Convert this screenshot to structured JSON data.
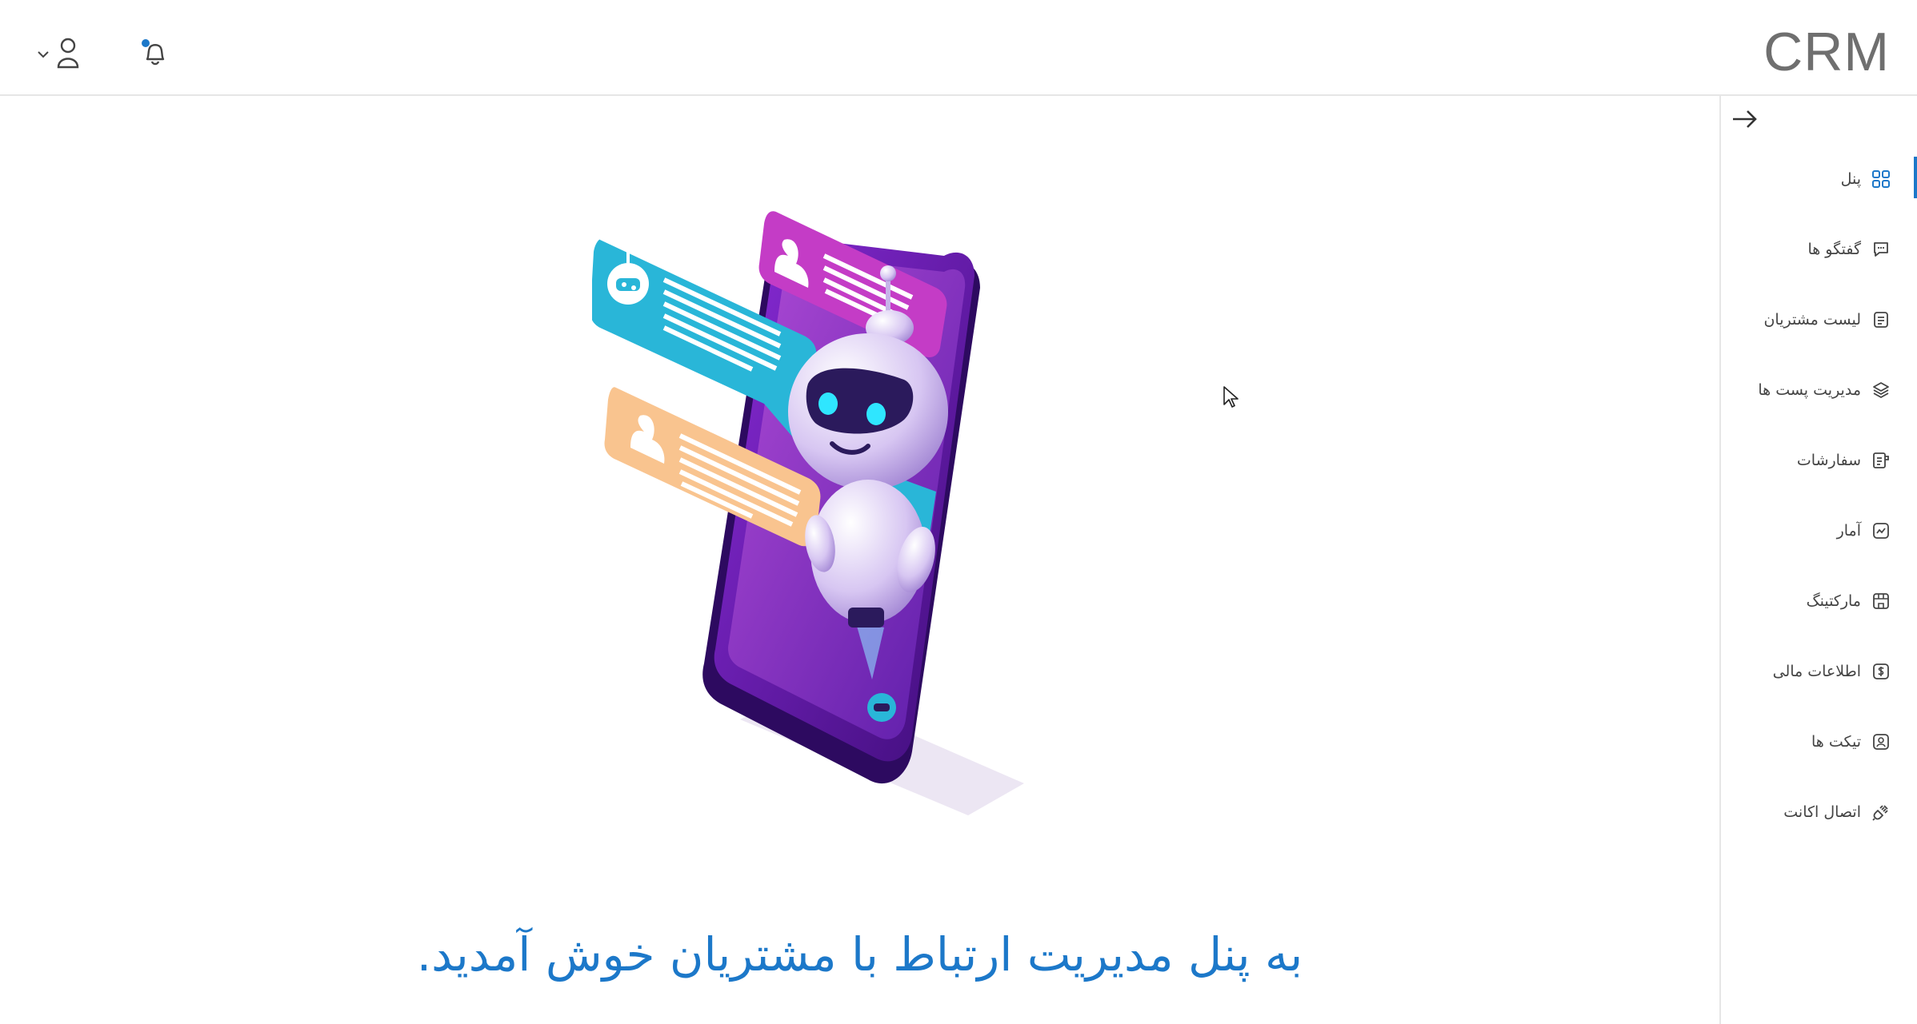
{
  "header": {
    "brand": "CRM",
    "user_icon": "user-icon",
    "dropdown_icon": "chevron-down-icon",
    "notification_icon": "bell-icon"
  },
  "sidebar": {
    "collapse_icon": "arrow-right-icon",
    "items": [
      {
        "label": "پنل",
        "icon": "grid-icon",
        "active": true
      },
      {
        "label": "گفتگو ها",
        "icon": "chat-icon"
      },
      {
        "label": "لیست مشتریان",
        "icon": "list-icon"
      },
      {
        "label": "مدیریت پست ها",
        "icon": "layers-icon"
      },
      {
        "label": "سفارشات",
        "icon": "orders-icon"
      },
      {
        "label": "آمار",
        "icon": "chart-icon"
      },
      {
        "label": "مارکتینگ",
        "icon": "store-icon"
      },
      {
        "label": "اطلاعات مالی",
        "icon": "dollar-icon"
      },
      {
        "label": "تیکت ها",
        "icon": "ticket-icon"
      },
      {
        "label": "اتصال اکانت",
        "icon": "plug-icon"
      }
    ]
  },
  "main": {
    "welcome": "به پنل مدیریت ارتباط با مشتریان خوش آمدید.",
    "illustration": "chatbot-phone-illustration"
  },
  "colors": {
    "accent": "#1c78c9",
    "cyan": "#29b6d8",
    "purple": "#6a1fb0",
    "magenta": "#c43cc6",
    "peach": "#f9c48f"
  }
}
